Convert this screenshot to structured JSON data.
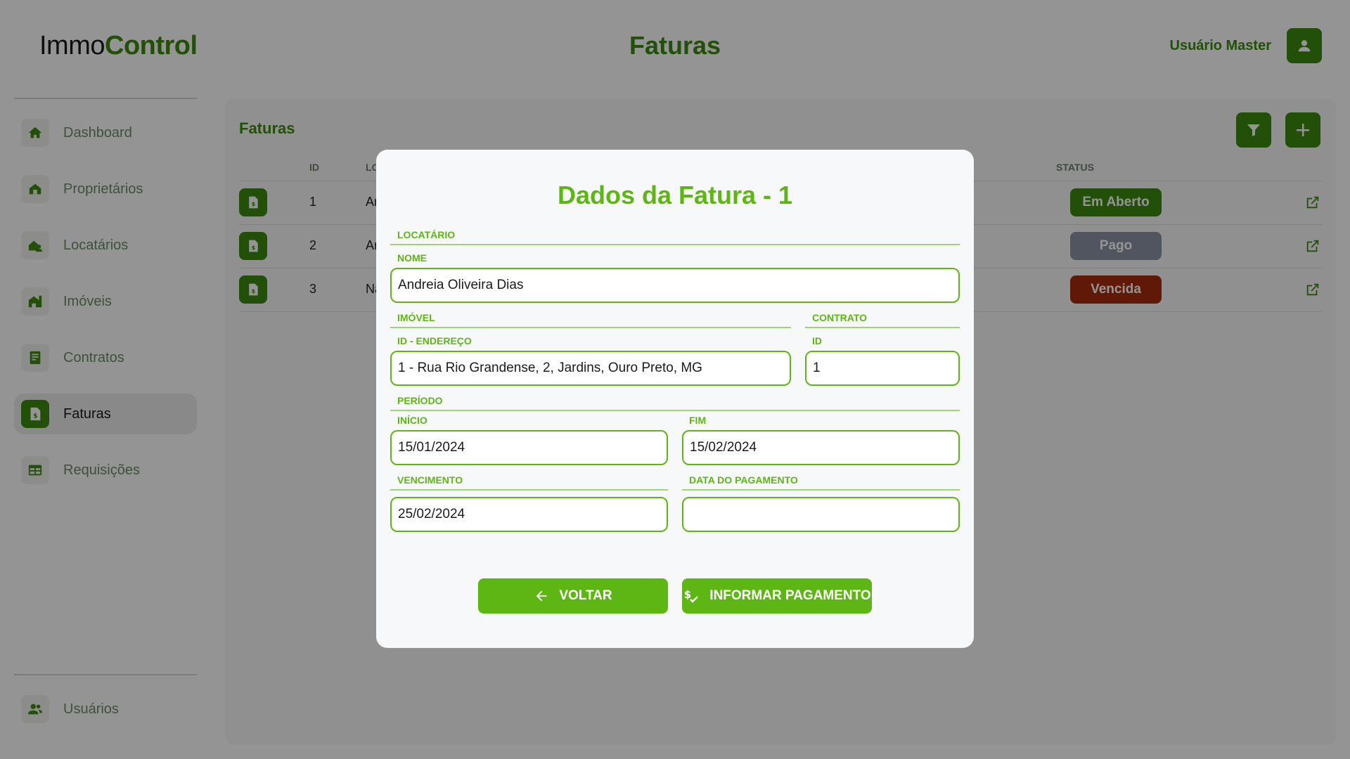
{
  "app": {
    "logo_part1": "Immo",
    "logo_part2": "Control",
    "page_title": "Faturas",
    "user_name": "Usuário Master"
  },
  "sidebar": {
    "items": [
      {
        "label": "Dashboard",
        "icon": "home-icon"
      },
      {
        "label": "Proprietários",
        "icon": "owner-icon"
      },
      {
        "label": "Locatários",
        "icon": "tenant-icon"
      },
      {
        "label": "Imóveis",
        "icon": "property-icon"
      },
      {
        "label": "Contratos",
        "icon": "contract-icon"
      },
      {
        "label": "Faturas",
        "icon": "invoice-icon",
        "active": true
      },
      {
        "label": "Requisições",
        "icon": "table-icon"
      }
    ],
    "footer_item": {
      "label": "Usuários",
      "icon": "users-icon"
    }
  },
  "table": {
    "title": "Faturas",
    "headers": {
      "id": "ID",
      "locatario": "LO",
      "status": "STATUS"
    },
    "rows": [
      {
        "id": "1",
        "locatario": "Ar",
        "status": "Em Aberto"
      },
      {
        "id": "2",
        "locatario": "Ar",
        "status": "Pago"
      },
      {
        "id": "3",
        "locatario": "Na",
        "status": "Vencida"
      }
    ]
  },
  "modal": {
    "title": "Dados da Fatura - 1",
    "sections": {
      "locatario": "LOCATÁRIO",
      "imovel": "IMÓVEL",
      "contrato": "CONTRATO",
      "periodo": "PERÍODO",
      "vencimento": "VENCIMENTO",
      "data_pagamento": "DATA DO PAGAMENTO"
    },
    "labels": {
      "nome": "NOME",
      "id_endereco": "ID - ENDEREÇO",
      "id": "ID",
      "inicio": "INÍCIO",
      "fim": "FIM"
    },
    "values": {
      "nome": "Andreia Oliveira Dias",
      "endereco": "1 - Rua Rio Grandense, 2, Jardins, Ouro Preto, MG",
      "contrato_id": "1",
      "inicio": "15/01/2024",
      "fim": "15/02/2024",
      "vencimento": "25/02/2024",
      "data_pagamento": ""
    },
    "buttons": {
      "back": "VOLTAR",
      "pay": "INFORMAR PAGAMENTO"
    }
  },
  "colors": {
    "brand_green": "#3d8b10",
    "modal_green": "#5db614",
    "status_open": "#3d8b10",
    "status_paid": "#8a93a6",
    "status_overdue": "#a52c0d"
  }
}
